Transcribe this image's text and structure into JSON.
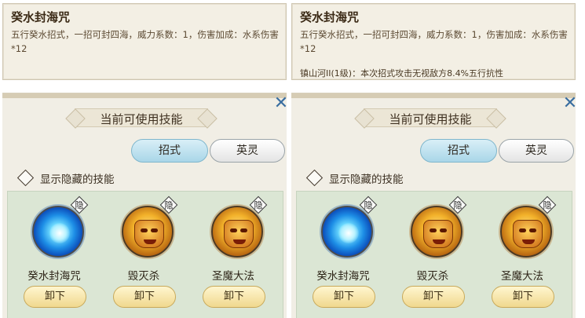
{
  "panels": [
    {
      "tooltip": {
        "title": "癸水封海咒",
        "desc": "五行癸水招式，一招可封四海，威力系数：1，伤害加成：水系伤害*12",
        "extra": ""
      },
      "banner": "当前可使用技能",
      "close_glyph": "✕",
      "tabs": [
        "招式",
        "英灵"
      ],
      "toggle_label": "显示隐藏的技能",
      "skills": [
        {
          "name": "癸水封海咒",
          "hide": "隐",
          "button": "卸下",
          "icon": "water-orb-icon"
        },
        {
          "name": "毁灭杀",
          "hide": "隐",
          "button": "卸下",
          "icon": "demon-face-icon"
        },
        {
          "name": "圣魔大法",
          "hide": "隐",
          "button": "卸下",
          "icon": "demon-face-icon"
        }
      ]
    },
    {
      "tooltip": {
        "title": "癸水封海咒",
        "desc": "五行癸水招式，一招可封四海，威力系数：1，伤害加成：水系伤害*12",
        "extra": "镇山河II(1级)：本次招式攻击无视敌方8.4%五行抗性"
      },
      "banner": "当前可使用技能",
      "close_glyph": "✕",
      "tabs": [
        "招式",
        "英灵"
      ],
      "toggle_label": "显示隐藏的技能",
      "skills": [
        {
          "name": "癸水封海咒",
          "hide": "隐",
          "button": "卸下",
          "icon": "water-orb-icon"
        },
        {
          "name": "毁灭杀",
          "hide": "隐",
          "button": "卸下",
          "icon": "demon-face-icon"
        },
        {
          "name": "圣魔大法",
          "hide": "隐",
          "button": "卸下",
          "icon": "demon-face-icon"
        }
      ]
    }
  ]
}
